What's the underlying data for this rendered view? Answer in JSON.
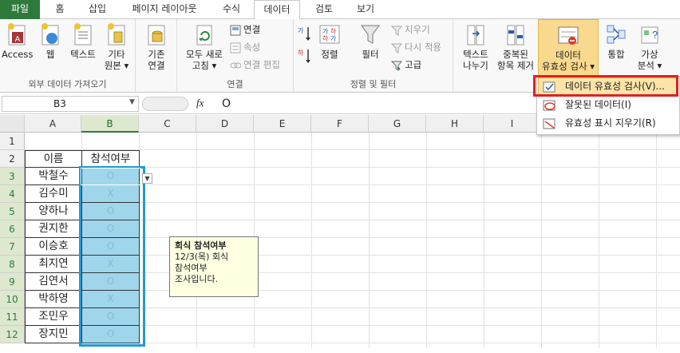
{
  "tabs": [
    "파일",
    "홈",
    "삽입",
    "페이지 레이아웃",
    "수식",
    "데이터",
    "검토",
    "보기"
  ],
  "ribbon": {
    "access": "Access",
    "web": "웹",
    "text": "텍스트",
    "other": "기타",
    "other2": "원본",
    "other_arrow": "▾",
    "existing": "기존",
    "existing2": "연결",
    "refresh": "모두 새로",
    "refresh2": "고침",
    "refresh_arrow": "▾",
    "connections": "연결",
    "properties": "속성",
    "edit_links": "연결 편집",
    "sort": "정렬",
    "filter": "필터",
    "clear": "지우기",
    "reapply": "다시 적용",
    "advanced": "고급",
    "text_to_col": "텍스트",
    "text_to_col2": "나누기",
    "remove_dup": "중복된",
    "remove_dup2": "항목 제거",
    "validation": "데이터",
    "validation2": "유효성 검사",
    "validation_arrow": "▾",
    "consolidate": "통합",
    "whatif": "가상",
    "whatif2": "분석",
    "whatif_arrow": "▾",
    "group_external": "외부 데이터 가져오기",
    "group_connections": "연결",
    "group_sortfilter": "정렬 및 필터"
  },
  "dropdown": [
    "데이터 유효성 검사(V)...",
    "잘못된 데이터(I)",
    "유효성 표시 지우기(R)"
  ],
  "formula": {
    "namebox": "B3",
    "fx": "fx",
    "value": "O"
  },
  "columns": [
    "A",
    "B",
    "C",
    "D",
    "E",
    "F",
    "G",
    "H",
    "I"
  ],
  "rows": [
    "1",
    "2",
    "3",
    "4",
    "5",
    "6",
    "7",
    "8",
    "9",
    "10",
    "11",
    "12"
  ],
  "header": {
    "name": "이름",
    "attend": "참석여부"
  },
  "people": [
    {
      "name": "박철수",
      "attend": "O"
    },
    {
      "name": "김수미",
      "attend": "X"
    },
    {
      "name": "양하나",
      "attend": "O"
    },
    {
      "name": "권지한",
      "attend": "O"
    },
    {
      "name": "이승호",
      "attend": "O"
    },
    {
      "name": "최지연",
      "attend": "X"
    },
    {
      "name": "김연서",
      "attend": "O"
    },
    {
      "name": "박하영",
      "attend": "X"
    },
    {
      "name": "조민우",
      "attend": "O"
    },
    {
      "name": "장지민",
      "attend": "O"
    }
  ],
  "tooltip": {
    "title": "회식 참석여부",
    "body1": "12/3(목) 회식",
    "body2": "참석여부",
    "body3": "조사입니다."
  },
  "colors": {
    "file_tab": "#2e7a3d",
    "selection": "#9fd6ec",
    "selection_border": "#1e9ad6",
    "highlight": "#e02020",
    "tooltip_bg": "#ffffe1"
  }
}
